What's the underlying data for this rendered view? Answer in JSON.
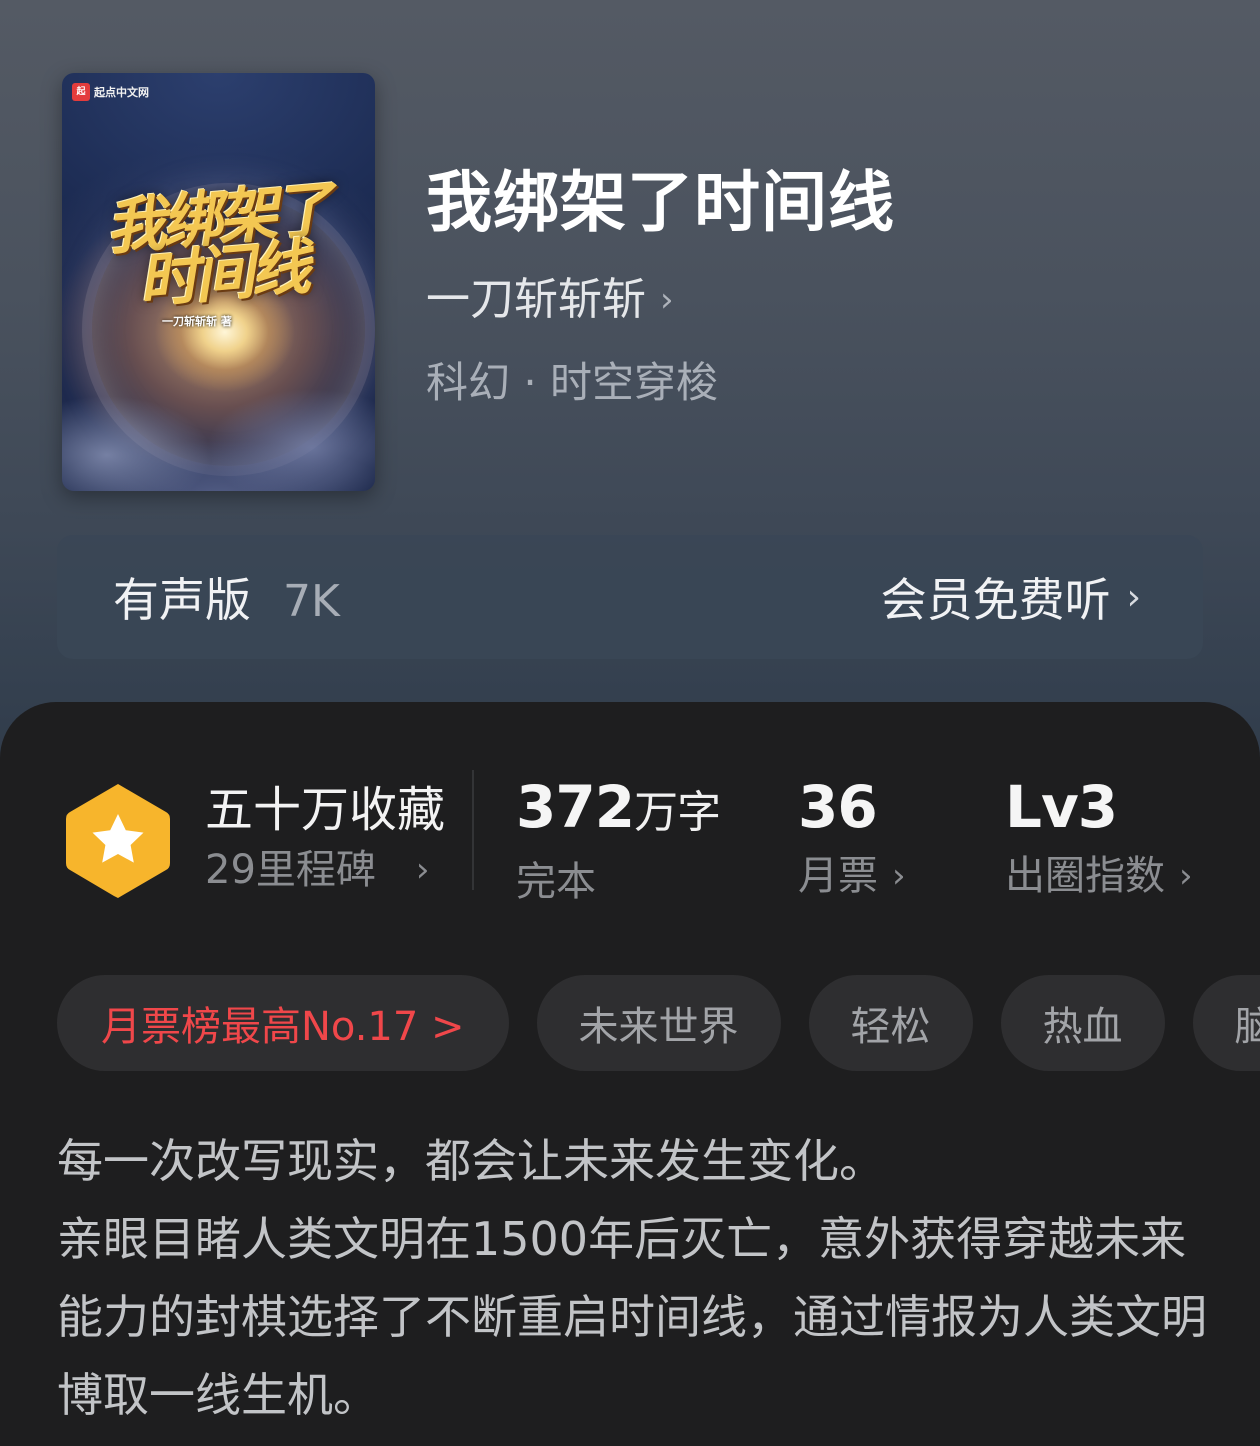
{
  "book": {
    "title": "我绑架了时间线",
    "author": "一刀斩斩斩",
    "genre": "科幻 · 时空穿梭",
    "cover": {
      "logo_text": "起点中文网",
      "title_line1": "我绑架了",
      "title_line2": "时间线",
      "author_text": "一刀斩斩斩 著"
    }
  },
  "audio": {
    "label": "有声版",
    "count": "7K",
    "cta": "会员免费听"
  },
  "stats": {
    "favorites": "五十万收藏",
    "milestones": "29里程碑",
    "words_value": "372",
    "words_unit": "万字",
    "status": "完本",
    "monthly_votes_value": "36",
    "monthly_votes_label": "月票",
    "index_value": "Lv3",
    "index_label": "出圈指数"
  },
  "tags": [
    "月票榜最高No.17 >",
    "未来世界",
    "轻松",
    "热血",
    "脑"
  ],
  "description": {
    "line1": "每一次改写现实，都会让未来发生变化。",
    "line2": "亲眼目睹人类文明在1500年后灭亡，意外获得穿越未来能力的封棋选择了不断重启时间线，通过情报为人类文明博取一线生机。"
  },
  "icons": {
    "chevron": "›",
    "badge": "star-hexagon-icon"
  },
  "colors": {
    "badge": "#f7b52c",
    "rank_tag": "#f0474a"
  }
}
